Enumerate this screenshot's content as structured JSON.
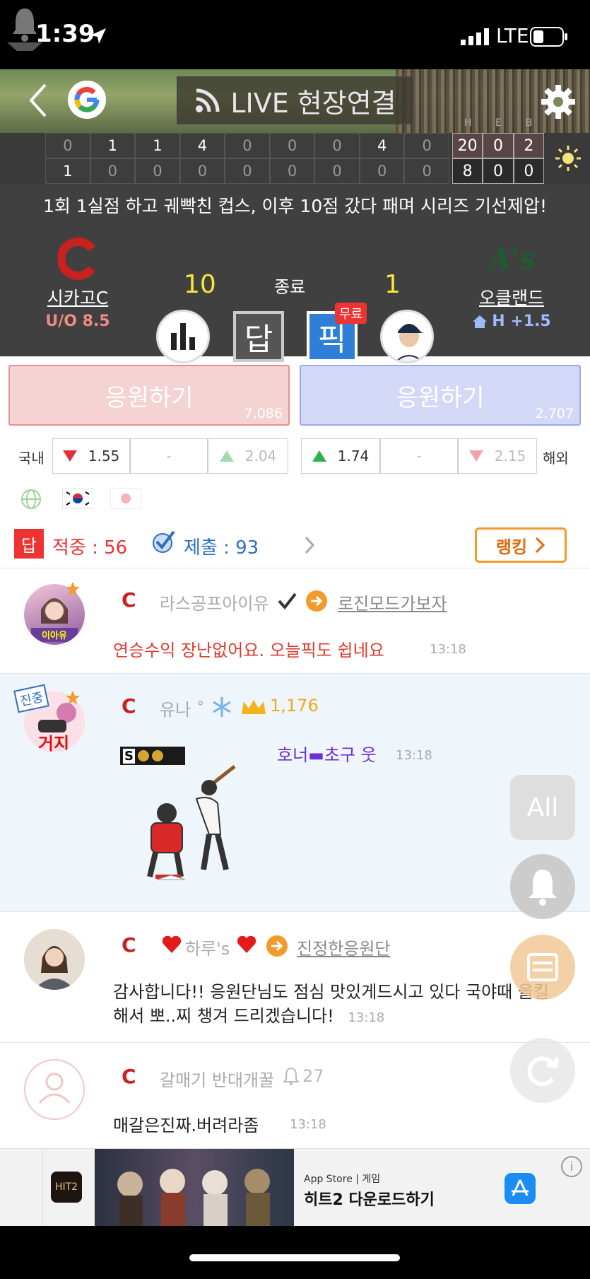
{
  "status_bar": {
    "time": "1:39",
    "network": "LTE"
  },
  "header": {
    "live_button_label": "LIVE 현장연결"
  },
  "scoreboard": {
    "away_innings": [
      "0",
      "1",
      "1",
      "4",
      "0",
      "0",
      "0",
      "4",
      "0"
    ],
    "home_innings": [
      "1",
      "0",
      "0",
      "0",
      "0",
      "0",
      "0",
      "0",
      "0"
    ],
    "heb_labels": [
      "H",
      "E",
      "B"
    ],
    "away_heb": [
      "20",
      "0",
      "2"
    ],
    "home_heb": [
      "8",
      "0",
      "0"
    ]
  },
  "summary": {
    "headline": "1회 1실점 하고 궤빡친 컵스, 이후 10점 갔다 패며 시리즈 기선제압!",
    "away_team": {
      "name": "시카고C",
      "score": "10",
      "odds_label": "U/O 8.5"
    },
    "home_team": {
      "name": "오클랜드",
      "score": "1",
      "odds_label": "H +1.5"
    },
    "game_status": "종료",
    "free_badge": "무료",
    "answer_label": "답",
    "pick_label": "픽"
  },
  "cheer": {
    "away": {
      "label": "응원하기",
      "count": "7,086",
      "color": "#f5d3d3"
    },
    "home": {
      "label": "응원하기",
      "count": "2,707",
      "color": "#d3d8f7"
    }
  },
  "odds": {
    "domestic_label": "국내",
    "overseas_label": "해외",
    "away": [
      "1.55",
      "-",
      "2.04"
    ],
    "home": [
      "1.74",
      "-",
      "2.15"
    ]
  },
  "stats": {
    "dap_label": "답",
    "hits": "적중 : 56",
    "submitted": "제출 : 93",
    "ranking_label": "랭킹"
  },
  "comments": [
    {
      "user": "라스공프아이유",
      "target": "로진모드가보자",
      "message": "연승수익 장난없어요. 오늘픽도 쉽네요",
      "time": "13:18",
      "avatar_label": "이아유"
    },
    {
      "user": "유나 ˚",
      "points": "1,176",
      "message": "호너▬초구 웃",
      "time": "13:18",
      "badge": "진중",
      "avatar_label": "거지",
      "sticker_label": "S"
    },
    {
      "user": "하루's",
      "target": "진정한응원단",
      "message": "감사합니다!! 응원단님도 점심 맛있게드시고 있다 국야때 올킬해서 뽀..찌 챙겨 드리겠습니다!",
      "time": "13:18"
    },
    {
      "user": "갈매기 반대개꿀",
      "points": "27",
      "message": "매갈은진짜.버려라좀",
      "time": "13:18"
    }
  ],
  "floating": {
    "all_label": "All"
  },
  "ad": {
    "store_label": "App Store | 게임",
    "title": "히트2 다운로드하기"
  }
}
